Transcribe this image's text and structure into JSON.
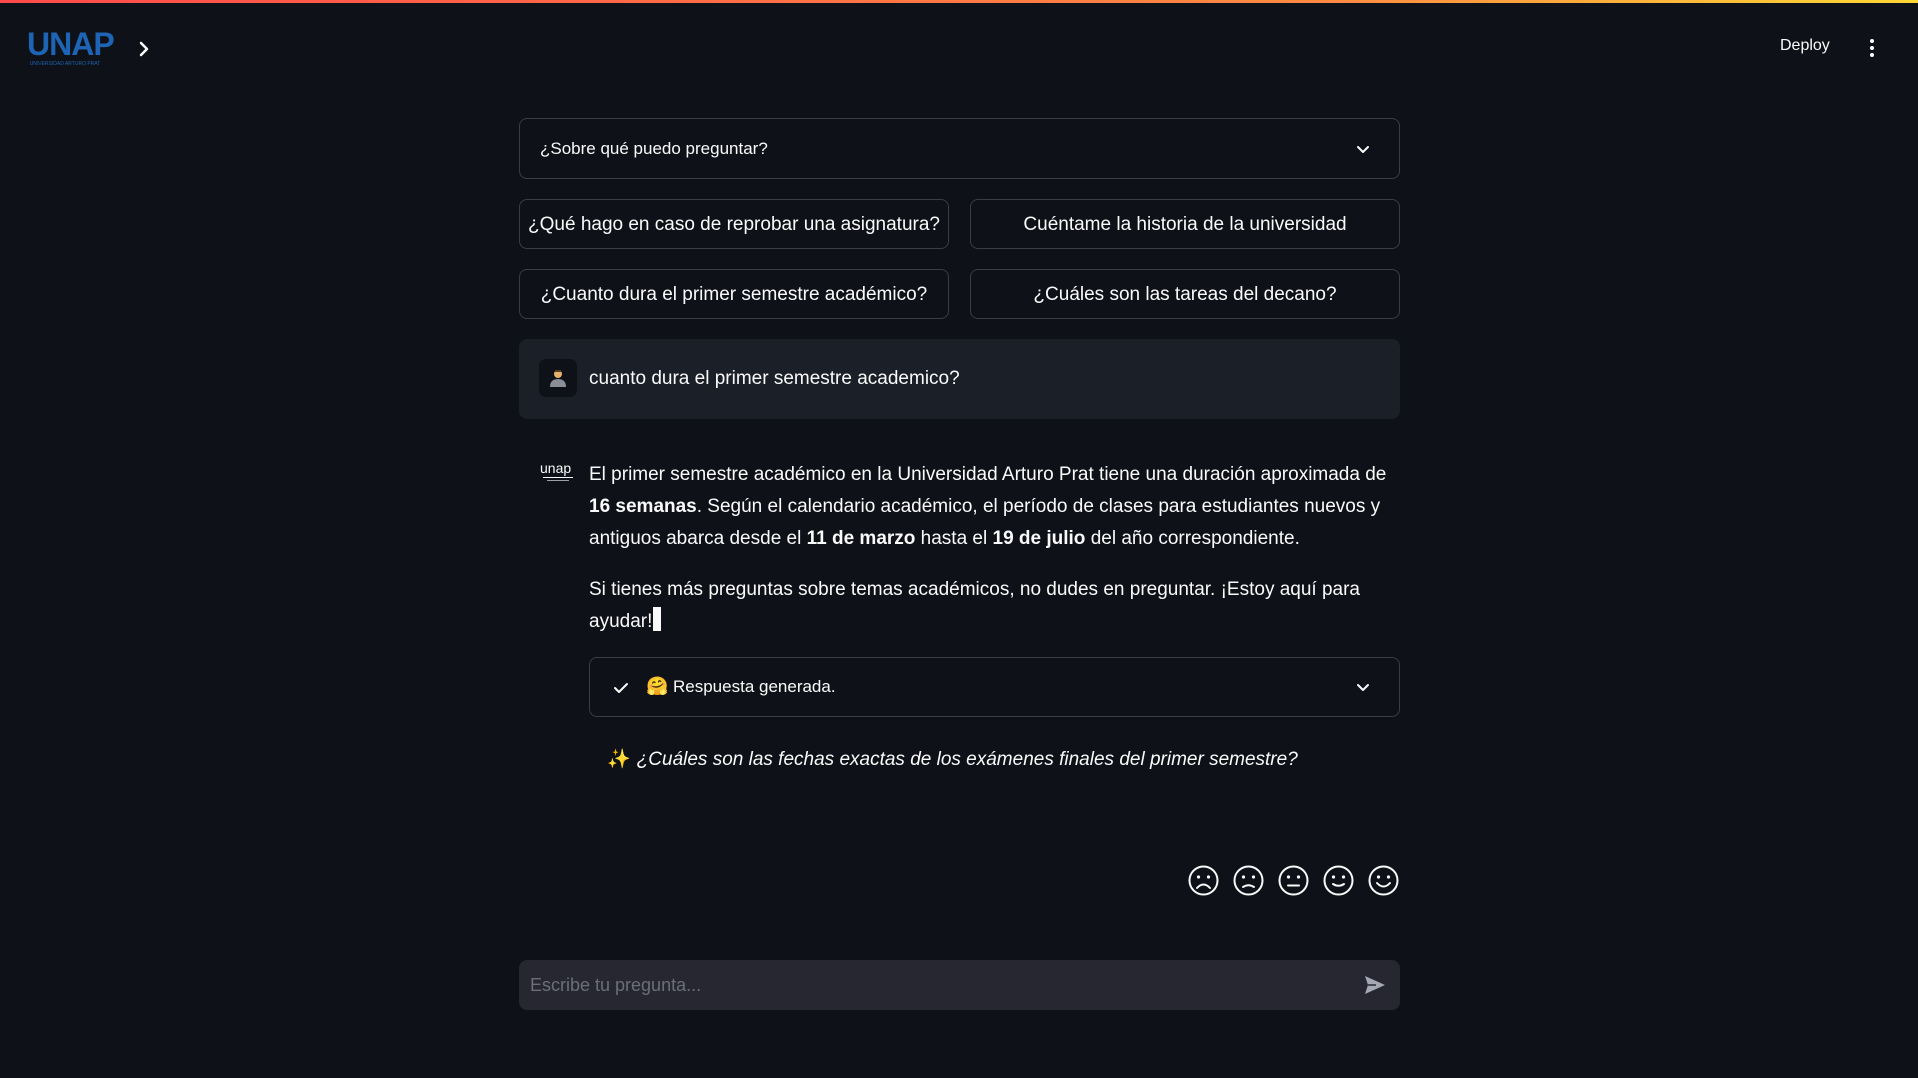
{
  "brand": {
    "logo_text": "UNAP",
    "logo_subtext": "UNIVERSIDAD ARTURO PRAT",
    "color": "#1e64b4",
    "accent_gradient": [
      "#ff4b4b",
      "#ff8c42",
      "#fdd835"
    ]
  },
  "header": {
    "deploy_label": "Deploy",
    "sidebar_icon": "chevron-right-icon",
    "menu_icon": "vertical-dots-icon"
  },
  "expander": {
    "label": "¿Sobre qué puedo preguntar?",
    "icon": "chevron-down-icon"
  },
  "suggestions": [
    {
      "label": "¿Qué hago en caso de reprobar una asignatura?"
    },
    {
      "label": "Cuéntame la historia de la universidad"
    },
    {
      "label": "¿Cuanto dura el primer semestre académico?"
    },
    {
      "label": "¿Cuáles son las tareas del decano?"
    }
  ],
  "user_message": {
    "avatar_icon": "user-avatar-icon",
    "text": "cuanto dura el primer semestre academico?"
  },
  "assistant_message": {
    "avatar_icon": "unap-logo-icon",
    "para1": {
      "t1": "El primer semestre académico en la Universidad Arturo Prat tiene una duración aproximada de ",
      "b1": "16 semanas",
      "t2": ". Según el calendario académico, el período de clases para estudiantes nuevos y antiguos abarca desde el ",
      "b2": "11 de marzo",
      "t3": " hasta el ",
      "b3": "19 de julio",
      "t4": " del año correspondiente."
    },
    "para2": "Si tienes más preguntas sobre temas académicos, no dudes en preguntar. ¡Estoy aquí para ayudar!"
  },
  "status": {
    "icon": "checkmark-icon",
    "emoji": "🤗",
    "text": "Respuesta generada.",
    "chevron": "chevron-down-icon"
  },
  "followup": {
    "icon": "sparkles-icon",
    "spark": "✨",
    "text": "¿Cuáles son las fechas exactas de los exámenes finales del primer semestre?"
  },
  "feedback": [
    {
      "icon": "face-very-sad-icon"
    },
    {
      "icon": "face-sad-icon"
    },
    {
      "icon": "face-neutral-icon"
    },
    {
      "icon": "face-happy-icon"
    },
    {
      "icon": "face-very-happy-icon"
    }
  ],
  "chat_input": {
    "placeholder": "Escribe tu pregunta...",
    "send_icon": "send-icon"
  }
}
